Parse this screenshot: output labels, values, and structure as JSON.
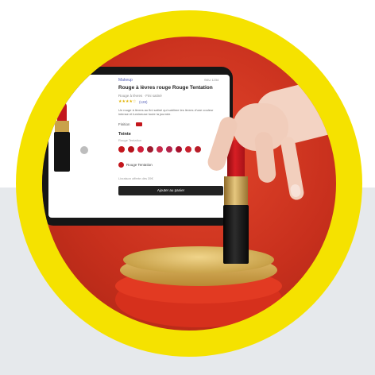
{
  "colors": {
    "ring": "#f5e200",
    "background_top": "#ffffff",
    "background_bottom": "#e6e9ec",
    "scene_red": "#d13b24",
    "lipstick_red": "#c3161c",
    "gold": "#c9a24a",
    "swatches": [
      "#c3161c",
      "#b5121b",
      "#d01f3a",
      "#9e1b2f",
      "#c72a4a",
      "#b3234a",
      "#a8102c",
      "#c8202d",
      "#b81d28"
    ]
  },
  "screen": {
    "breadcrumb": "Makeup",
    "header_right": "SKU 1234",
    "product_title": "Rouge à lèvres rouge Rouge Tentation",
    "subtitle": "Rouge à lèvres · Fini satiné",
    "rating": "★★★★☆",
    "rating_link": "(128)",
    "description": "Un rouge à lèvres au fini satiné qui sublime les lèvres d'une couleur intense et lumineuse toute la journée.",
    "tag": "Finition",
    "shade_label": "Teinte",
    "shade_sublabel": "Rouge Tentation",
    "selected_shade": "Rouge Tentation",
    "small_note": "Livraison offerte dès 35€",
    "cta_label": "Ajouter au panier"
  },
  "icons": [
    "lipstick-icon",
    "hand-icon",
    "pedestal-icon",
    "carousel-dot-icon",
    "tablet-icon"
  ]
}
